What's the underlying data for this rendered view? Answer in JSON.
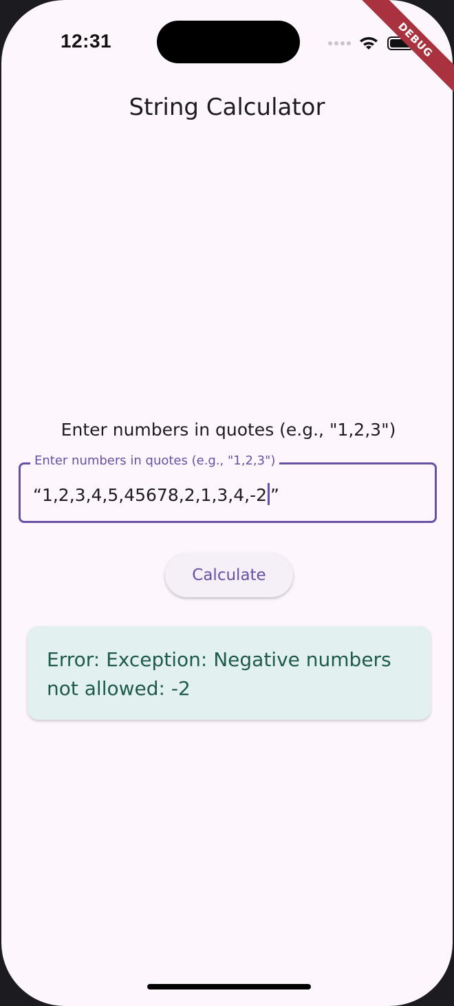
{
  "status_bar": {
    "time": "12:31",
    "debug_banner": "DEBUG"
  },
  "app_bar": {
    "title": "String Calculator"
  },
  "form": {
    "instruction": "Enter numbers in quotes (e.g., \"1,2,3\")",
    "input_label": "Enter numbers in quotes (e.g., \"1,2,3\")",
    "input_value_before_caret": "“1,2,3,4,5,45678,2,1,3,4,-2",
    "input_value_after_caret": "”",
    "button_label": "Calculate"
  },
  "result": {
    "error_message": "Error: Exception: Negative numbers not allowed: -2"
  },
  "colors": {
    "background": "#fdf7fd",
    "primary": "#6750a4",
    "error_card_bg": "#e2f0ef",
    "error_text": "#1d5a4a"
  },
  "icons": [
    "signal-dots-icon",
    "wifi-icon",
    "battery-icon"
  ]
}
